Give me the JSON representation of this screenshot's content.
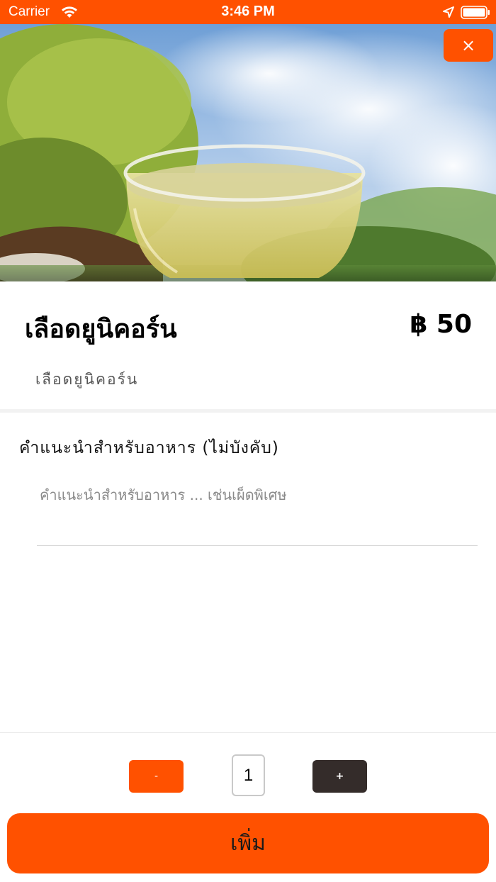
{
  "status_bar": {
    "carrier": "Carrier",
    "time": "3:46 PM",
    "wifi_icon": "wifi-icon",
    "location_icon": "location-arrow-icon",
    "battery_icon": "battery-full-icon"
  },
  "hero": {
    "image_icon": "herbal-drink-photo",
    "close_label": "×"
  },
  "product": {
    "name": "เลือดยูนิคอร์น",
    "price": "฿ 50",
    "description": "เลือดยูนิคอร์น"
  },
  "note": {
    "label": "คำแนะนำสำหรับอาหาร (ไม่บังคับ)",
    "placeholder": "คำแนะนำสำหรับอาหาร ... เช่นเผ็ดพิเศษ",
    "value": ""
  },
  "quantity": {
    "minus_label": "-",
    "value": "1",
    "plus_label": "+"
  },
  "add_button": {
    "label": "เพิ่ม"
  },
  "colors": {
    "accent": "#ff5100",
    "dark_button": "#342c2a"
  }
}
